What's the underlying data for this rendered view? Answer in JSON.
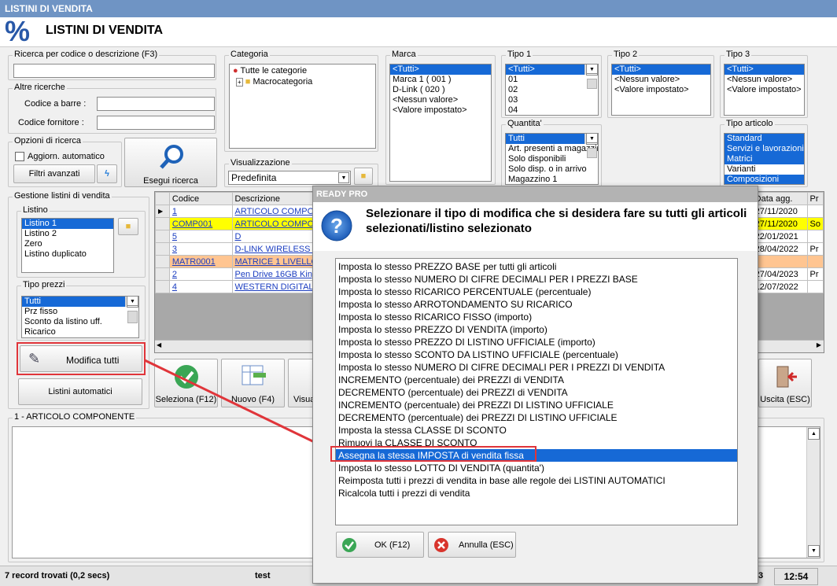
{
  "window": {
    "title": "LISTINI DI VENDITA",
    "header_icon": "%",
    "header_title": "LISTINI DI VENDITA"
  },
  "search": {
    "label": "Ricerca per codice o descrizione (F3)",
    "value": ""
  },
  "other": {
    "label": "Altre ricerche",
    "barcode_label": "Codice a barre :",
    "supplier_label": "Codice fornitore :"
  },
  "options": {
    "label": "Opzioni di ricerca",
    "auto_update": "Aggiorn. automatico",
    "filters_btn": "Filtri avanzati",
    "execute_btn": "Esegui ricerca"
  },
  "categoria": {
    "label": "Categoria",
    "items": [
      "Tutte le categorie",
      "Macrocategoria"
    ]
  },
  "visual": {
    "label": "Visualizzazione",
    "value": "Predefinita"
  },
  "marca": {
    "label": "Marca",
    "items": [
      "<Tutti>",
      "Marca 1 ( 001 )",
      "D-Link ( 020 )",
      "<Nessun valore>",
      "<Valore impostato>"
    ]
  },
  "tipo1": {
    "label": "Tipo 1",
    "items": [
      "<Tutti>",
      "01",
      "02",
      "03",
      "04"
    ]
  },
  "tipo2": {
    "label": "Tipo 2",
    "items": [
      "<Tutti>",
      "<Nessun valore>",
      "<Valore impostato>"
    ]
  },
  "tipo3": {
    "label": "Tipo 3",
    "items": [
      "<Tutti>",
      "<Nessun valore>",
      "<Valore impostato>"
    ]
  },
  "quantita": {
    "label": "Quantita'",
    "items": [
      "Tutti",
      "Art. presenti a magazzino",
      "Solo disponibili",
      "Solo disp. o in arrivo",
      "Magazzino 1"
    ]
  },
  "tipo_art": {
    "label": "Tipo articolo",
    "items": [
      "Standard",
      "Servizi e lavorazioni",
      "Matrici",
      "Varianti",
      "Composizioni"
    ]
  },
  "gestione": {
    "label": "Gestione listini di vendita",
    "listino_label": "Listino",
    "listini": [
      "Listino 1",
      "Listino 2",
      "Zero",
      "Listino duplicato"
    ],
    "tipo_prezzi_label": "Tipo prezzi",
    "tipi": [
      "Tutti",
      "Prz fisso",
      "Sconto da listino uff.",
      "Ricarico"
    ],
    "modifica_btn": "Modifica tutti",
    "auto_btn": "Listini automatici"
  },
  "grid": {
    "col_code": "Codice",
    "col_desc": "Descrizione",
    "col_date": "Data agg.",
    "col_pr": "Pr",
    "rows": [
      {
        "code": "1",
        "desc": "ARTICOLO COMPONENTE",
        "date": "27/11/2020",
        "pr": "",
        "bg": "#ffffff"
      },
      {
        "code": "COMP001",
        "desc": "ARTICOLO COMPOSTO",
        "date": "27/11/2020",
        "pr": "So",
        "bg": "#ffff00"
      },
      {
        "code": "5",
        "desc": "D",
        "date": "22/01/2021",
        "pr": "",
        "bg": "#ffffff"
      },
      {
        "code": "3",
        "desc": "D-LINK WIRELESS AC",
        "date": "28/04/2022",
        "pr": "Pr",
        "bg": "#ffffff"
      },
      {
        "code": "MATR0001",
        "desc": "MATRICE 1 LIVELLO",
        "date": "",
        "pr": "",
        "bg": "#ffc591"
      },
      {
        "code": "2",
        "desc": "Pen Drive 16GB Kingston",
        "date": "27/04/2023",
        "pr": "Pr",
        "bg": "#ffffff"
      },
      {
        "code": "4",
        "desc": "WESTERN DIGITAL EX",
        "date": "12/07/2022",
        "pr": "",
        "bg": "#ffffff"
      }
    ]
  },
  "toolbar": {
    "seleziona": "Seleziona (F12)",
    "nuovo": "Nuovo (F4)",
    "visual": "Visua",
    "uscita": "Uscita (ESC)"
  },
  "detail": {
    "label": "1 - ARTICOLO COMPONENTE"
  },
  "dialog": {
    "title": "READY PRO",
    "question": "Selezionare il tipo di modifica che si desidera fare su tutti gli articoli selezionati/listino selezionato",
    "options": [
      "Imposta lo stesso PREZZO BASE per tutti gli articoli",
      "Imposta lo stesso NUMERO DI CIFRE DECIMALI PER I PREZZI BASE",
      "Imposta lo stesso RICARICO PERCENTUALE (percentuale)",
      "Imposta lo stesso ARROTONDAMENTO SU RICARICO",
      "Imposta lo stesso RICARICO FISSO (importo)",
      "Imposta lo stesso PREZZO DI VENDITA (importo)",
      "Imposta lo stesso PREZZO DI LISTINO UFFICIALE (importo)",
      "Imposta lo stesso SCONTO DA LISTINO UFFICIALE (percentuale)",
      "Imposta lo stesso NUMERO DI CIFRE DECIMALI PER I PREZZI DI VENDITA",
      "INCREMENTO (percentuale) dei PREZZI di VENDITA",
      "DECREMENTO (percentuale) dei PREZZI di VENDITA",
      "INCREMENTO (percentuale) dei PREZZI DI LISTINO UFFICIALE",
      "DECREMENTO (percentuale) dei PREZZI DI LISTINO UFFICIALE",
      "Imposta la stessa CLASSE DI SCONTO",
      "Rimuovi la CLASSE DI SCONTO",
      "Assegna la stessa IMPOSTA di vendita fissa",
      "Imposta lo stesso LOTTO DI VENDITA (quantita')",
      "Reimposta tutti i prezzi di vendita in base alle regole dei LISTINI AUTOMATICI",
      "Ricalcola tutti i prezzi di vendita"
    ],
    "ok": "OK (F12)",
    "cancel": "Annulla (ESC)"
  },
  "status": {
    "records": "7 record trovati (0,2 secs)",
    "user": "test",
    "num": "3",
    "time": "12:54"
  },
  "colors": {
    "accent": "#1669d6",
    "highlight": "#e0353a",
    "title": "#6f94c4"
  }
}
